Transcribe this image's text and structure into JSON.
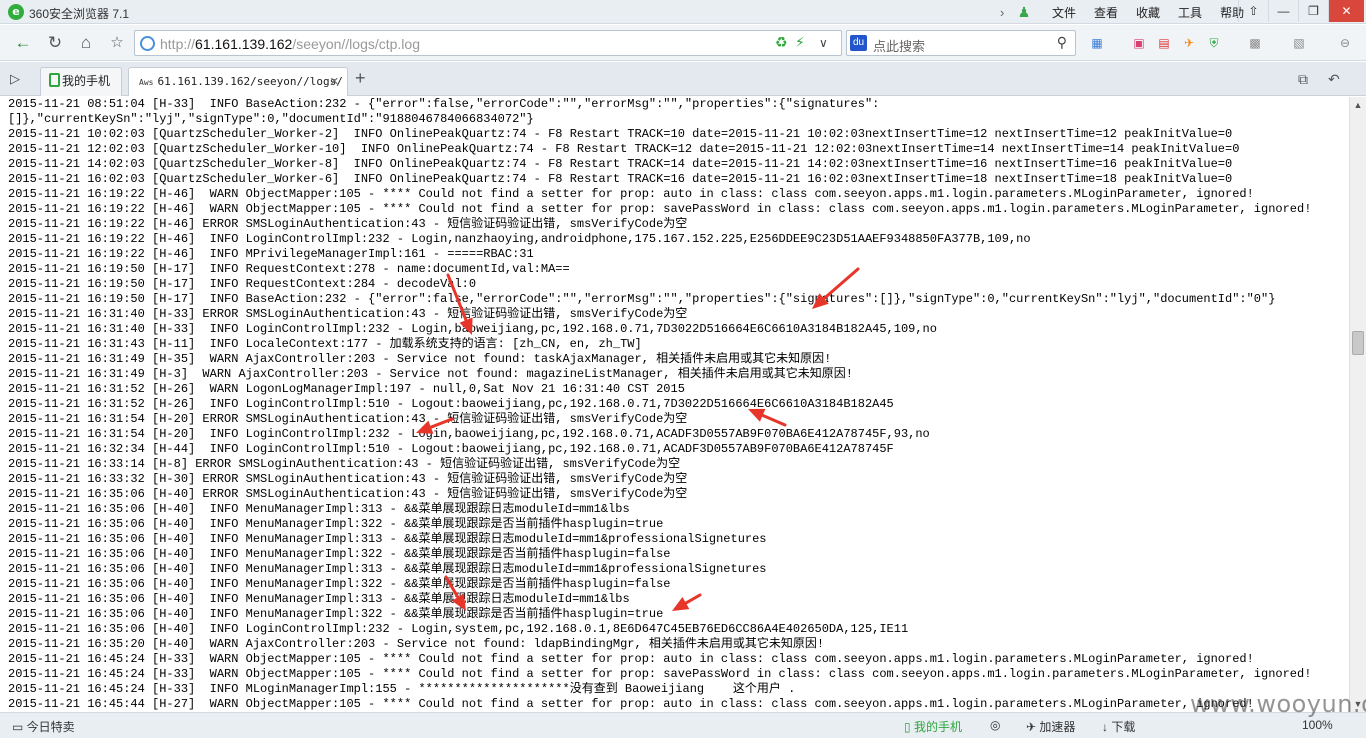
{
  "window": {
    "app_title": "360安全浏览器 7.1",
    "menu": [
      "文件",
      "查看",
      "收藏",
      "工具",
      "帮助"
    ],
    "controls": [
      "⇧",
      "—",
      "❐",
      "✕"
    ]
  },
  "navbar": {
    "url_prefix": "http://",
    "url_host": "61.161.139.162",
    "url_path": "/seeyon//logs/ctp.log",
    "search_placeholder": "点此搜索"
  },
  "tabs": [
    {
      "label": "我的手机"
    },
    {
      "label": "61.161.139.162/seeyon//logs/",
      "favicon_text": "Aws"
    }
  ],
  "log_lines": [
    "2015-11-21 08:51:04 [H-33]  INFO BaseAction:232 - {\"error\":false,\"errorCode\":\"\",\"errorMsg\":\"\",\"properties\":{\"signatures\":",
    "[]},\"currentKeySn\":\"lyj\",\"signType\":0,\"documentId\":\"9188046784066834072\"}",
    "2015-11-21 10:02:03 [QuartzScheduler_Worker-2]  INFO OnlinePeakQuartz:74 - F8 Restart TRACK=10 date=2015-11-21 10:02:03nextInsertTime=12 nextInsertTime=12 peakInitValue=0",
    "2015-11-21 12:02:03 [QuartzScheduler_Worker-10]  INFO OnlinePeakQuartz:74 - F8 Restart TRACK=12 date=2015-11-21 12:02:03nextInsertTime=14 nextInsertTime=14 peakInitValue=0",
    "2015-11-21 14:02:03 [QuartzScheduler_Worker-8]  INFO OnlinePeakQuartz:74 - F8 Restart TRACK=14 date=2015-11-21 14:02:03nextInsertTime=16 nextInsertTime=16 peakInitValue=0",
    "2015-11-21 16:02:03 [QuartzScheduler_Worker-6]  INFO OnlinePeakQuartz:74 - F8 Restart TRACK=16 date=2015-11-21 16:02:03nextInsertTime=18 nextInsertTime=18 peakInitValue=0",
    "2015-11-21 16:19:22 [H-46]  WARN ObjectMapper:105 - **** Could not find a setter for prop: auto in class: class com.seeyon.apps.m1.login.parameters.MLoginParameter, ignored!",
    "2015-11-21 16:19:22 [H-46]  WARN ObjectMapper:105 - **** Could not find a setter for prop: savePassWord in class: class com.seeyon.apps.m1.login.parameters.MLoginParameter, ignored!",
    "2015-11-21 16:19:22 [H-46] ERROR SMSLoginAuthentication:43 - 短信验证码验证出错, smsVerifyCode为空",
    "2015-11-21 16:19:22 [H-46]  INFO LoginControlImpl:232 - Login,nanzhaoying,androidphone,175.167.152.225,E256DDEE9C23D51AAEF9348850FA377B,109,no",
    "2015-11-21 16:19:22 [H-46]  INFO MPrivilegeManagerImpl:161 - =====RBAC:31",
    "2015-11-21 16:19:50 [H-17]  INFO RequestContext:278 - name:documentId,val:MA==",
    "2015-11-21 16:19:50 [H-17]  INFO RequestContext:284 - decodeVal:0",
    "2015-11-21 16:19:50 [H-17]  INFO BaseAction:232 - {\"error\":false,\"errorCode\":\"\",\"errorMsg\":\"\",\"properties\":{\"signatures\":[]},\"signType\":0,\"currentKeySn\":\"lyj\",\"documentId\":\"0\"}",
    "2015-11-21 16:31:40 [H-33] ERROR SMSLoginAuthentication:43 - 短信验证码验证出错, smsVerifyCode为空",
    "2015-11-21 16:31:40 [H-33]  INFO LoginControlImpl:232 - Login,baoweijiang,pc,192.168.0.71,7D3022D516664E6C6610A3184B182A45,109,no",
    "2015-11-21 16:31:43 [H-11]  INFO LocaleContext:177 - 加载系统支持的语言: [zh_CN, en, zh_TW]",
    "2015-11-21 16:31:49 [H-35]  WARN AjaxController:203 - Service not found: taskAjaxManager, 相关插件未启用或其它未知原因!",
    "2015-11-21 16:31:49 [H-3]  WARN AjaxController:203 - Service not found: magazineListManager, 相关插件未启用或其它未知原因!",
    "2015-11-21 16:31:52 [H-26]  WARN LogonLogManagerImpl:197 - null,0,Sat Nov 21 16:31:40 CST 2015",
    "2015-11-21 16:31:52 [H-26]  INFO LoginControlImpl:510 - Logout:baoweijiang,pc,192.168.0.71,7D3022D516664E6C6610A3184B182A45",
    "2015-11-21 16:31:54 [H-20] ERROR SMSLoginAuthentication:43 - 短信验证码验证出错, smsVerifyCode为空",
    "2015-11-21 16:31:54 [H-20]  INFO LoginControlImpl:232 - Login,baoweijiang,pc,192.168.0.71,ACADF3D0557AB9F070BA6E412A78745F,93,no",
    "2015-11-21 16:32:34 [H-44]  INFO LoginControlImpl:510 - Logout:baoweijiang,pc,192.168.0.71,ACADF3D0557AB9F070BA6E412A78745F",
    "2015-11-21 16:33:14 [H-8] ERROR SMSLoginAuthentication:43 - 短信验证码验证出错, smsVerifyCode为空",
    "2015-11-21 16:33:32 [H-30] ERROR SMSLoginAuthentication:43 - 短信验证码验证出错, smsVerifyCode为空",
    "2015-11-21 16:35:06 [H-40] ERROR SMSLoginAuthentication:43 - 短信验证码验证出错, smsVerifyCode为空",
    "2015-11-21 16:35:06 [H-40]  INFO MenuManagerImpl:313 - &&菜单展现跟踪日志moduleId=mm1&lbs",
    "2015-11-21 16:35:06 [H-40]  INFO MenuManagerImpl:322 - &&菜单展现跟踪是否当前插件hasplugin=true",
    "2015-11-21 16:35:06 [H-40]  INFO MenuManagerImpl:313 - &&菜单展现跟踪日志moduleId=mm1&professionalSignetures",
    "2015-11-21 16:35:06 [H-40]  INFO MenuManagerImpl:322 - &&菜单展现跟踪是否当前插件hasplugin=false",
    "2015-11-21 16:35:06 [H-40]  INFO MenuManagerImpl:313 - &&菜单展现跟踪日志moduleId=mm1&professionalSignetures",
    "2015-11-21 16:35:06 [H-40]  INFO MenuManagerImpl:322 - &&菜单展现跟踪是否当前插件hasplugin=false",
    "2015-11-21 16:35:06 [H-40]  INFO MenuManagerImpl:313 - &&菜单展现跟踪日志moduleId=mm1&lbs",
    "2015-11-21 16:35:06 [H-40]  INFO MenuManagerImpl:322 - &&菜单展现跟踪是否当前插件hasplugin=true",
    "2015-11-21 16:35:06 [H-40]  INFO LoginControlImpl:232 - Login,system,pc,192.168.0.1,8E6D647C45EB76ED6CC86A4E402650DA,125,IE11",
    "2015-11-21 16:35:20 [H-40]  WARN AjaxController:203 - Service not found: ldapBindingMgr, 相关插件未启用或其它未知原因!",
    "2015-11-21 16:45:24 [H-33]  WARN ObjectMapper:105 - **** Could not find a setter for prop: auto in class: class com.seeyon.apps.m1.login.parameters.MLoginParameter, ignored!",
    "2015-11-21 16:45:24 [H-33]  WARN ObjectMapper:105 - **** Could not find a setter for prop: savePassWord in class: class com.seeyon.apps.m1.login.parameters.MLoginParameter, ignored!",
    "2015-11-21 16:45:24 [H-33]  INFO MLoginManagerImpl:155 - *********************没有查到 Baoweijiang    这个用户 .",
    "2015-11-21 16:45:44 [H-27]  WARN ObjectMapper:105 - **** Could not find a setter for prop: auto in class: class com.seeyon.apps.m1.login.parameters.MLoginParameter, ignored!"
  ],
  "annotation_color": "#e8352a",
  "statusbar": {
    "left": "今日特卖",
    "phone": "我的手机",
    "accelerator": "加速器",
    "download": "下载",
    "zoom": "100%"
  },
  "watermark": "www.wooyun.org"
}
